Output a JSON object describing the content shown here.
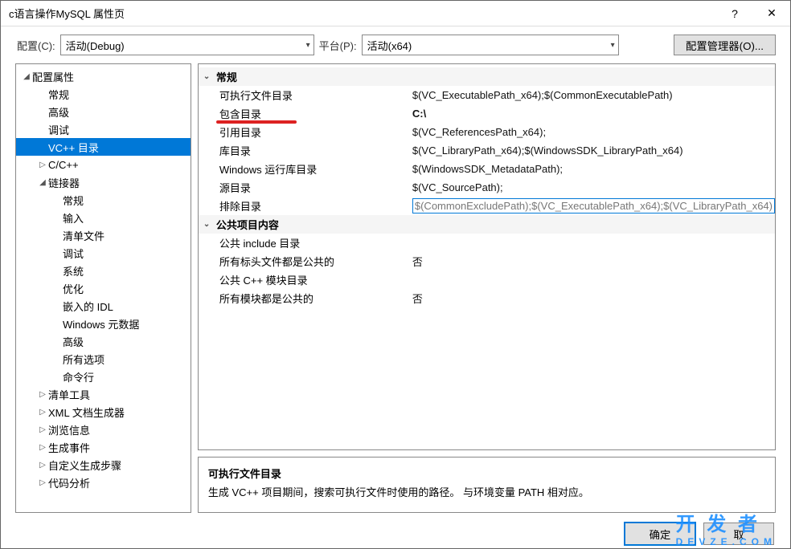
{
  "window": {
    "title": "c语言操作MySQL 属性页"
  },
  "toolbar": {
    "config_label": "配置(C):",
    "config_value": "活动(Debug)",
    "platform_label": "平台(P):",
    "platform_value": "活动(x64)",
    "config_manager_btn": "配置管理器(O)..."
  },
  "tree": {
    "root": "配置属性",
    "items": [
      {
        "label": "常规",
        "indent": 2
      },
      {
        "label": "高级",
        "indent": 2
      },
      {
        "label": "调试",
        "indent": 2
      },
      {
        "label": "VC++ 目录",
        "indent": 2,
        "selected": true
      },
      {
        "label": "C/C++",
        "indent": 2,
        "exp": "closed"
      },
      {
        "label": "链接器",
        "indent": 2,
        "exp": "open"
      },
      {
        "label": "常规",
        "indent": 3
      },
      {
        "label": "输入",
        "indent": 3
      },
      {
        "label": "清单文件",
        "indent": 3
      },
      {
        "label": "调试",
        "indent": 3
      },
      {
        "label": "系统",
        "indent": 3
      },
      {
        "label": "优化",
        "indent": 3
      },
      {
        "label": "嵌入的 IDL",
        "indent": 3
      },
      {
        "label": "Windows 元数据",
        "indent": 3
      },
      {
        "label": "高级",
        "indent": 3
      },
      {
        "label": "所有选项",
        "indent": 3
      },
      {
        "label": "命令行",
        "indent": 3
      },
      {
        "label": "清单工具",
        "indent": 2,
        "exp": "closed"
      },
      {
        "label": "XML 文档生成器",
        "indent": 2,
        "exp": "closed"
      },
      {
        "label": "浏览信息",
        "indent": 2,
        "exp": "closed"
      },
      {
        "label": "生成事件",
        "indent": 2,
        "exp": "closed"
      },
      {
        "label": "自定义生成步骤",
        "indent": 2,
        "exp": "closed"
      },
      {
        "label": "代码分析",
        "indent": 2,
        "exp": "closed"
      }
    ]
  },
  "grid": {
    "cat1": "常规",
    "rows1": [
      {
        "k": "可执行文件目录",
        "v": "$(VC_ExecutablePath_x64);$(CommonExecutablePath)"
      },
      {
        "k": "包含目录",
        "v": "C:\\",
        "mark": true,
        "bold": true
      },
      {
        "k": "引用目录",
        "v": "$(VC_ReferencesPath_x64);"
      },
      {
        "k": "库目录",
        "v": "$(VC_LibraryPath_x64);$(WindowsSDK_LibraryPath_x64)"
      },
      {
        "k": "Windows 运行库目录",
        "v": "$(WindowsSDK_MetadataPath);"
      },
      {
        "k": "源目录",
        "v": "$(VC_SourcePath);"
      },
      {
        "k": "排除目录",
        "v": "$(CommonExcludePath);$(VC_ExecutablePath_x64);$(VC_LibraryPath_x64)",
        "excl": true
      }
    ],
    "cat2": "公共项目内容",
    "rows2": [
      {
        "k": "公共 include 目录",
        "v": ""
      },
      {
        "k": "所有标头文件都是公共的",
        "v": "否"
      },
      {
        "k": "公共 C++ 模块目录",
        "v": ""
      },
      {
        "k": "所有模块都是公共的",
        "v": "否"
      }
    ]
  },
  "description": {
    "title": "可执行文件目录",
    "text": "生成 VC++ 项目期间，搜索可执行文件时使用的路径。    与环境变量 PATH 相对应。"
  },
  "footer": {
    "ok": "确定",
    "cancel": "取"
  },
  "watermark": {
    "big": "开 发 者",
    "small": "DEVZE.COM"
  }
}
